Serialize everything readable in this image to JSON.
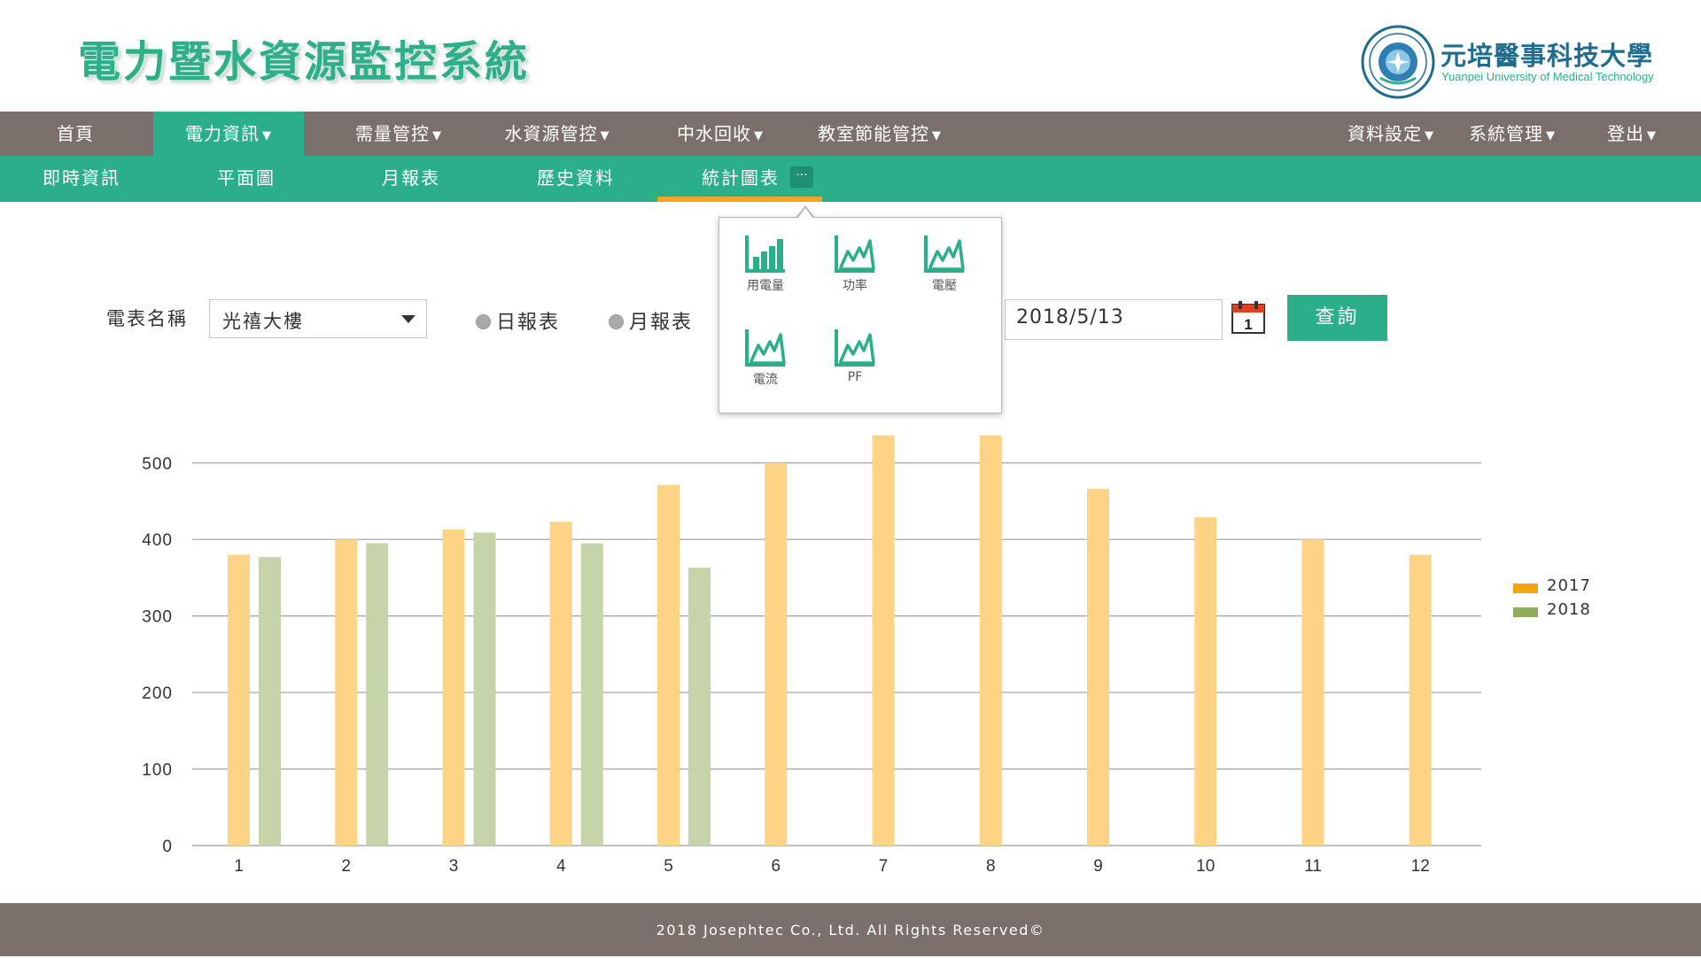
{
  "header": {
    "app_title": "電力暨水資源監控系統",
    "university_name": "元培醫事科技大學",
    "university_en": "Yuanpei University of Medical Technology"
  },
  "nav_main": {
    "items": [
      {
        "label": "首頁"
      },
      {
        "label": "電力資訊",
        "caret": "▼",
        "active": true
      },
      {
        "label": "需量管控",
        "caret": "▼"
      },
      {
        "label": "水資源管控",
        "caret": "▼"
      },
      {
        "label": "中水回收",
        "caret": "▼"
      },
      {
        "label": "教室節能管控",
        "caret": "▼"
      }
    ],
    "right_items": [
      {
        "label": "資料設定",
        "caret": "▼"
      },
      {
        "label": "系統管理",
        "caret": "▼"
      },
      {
        "label": "登出",
        "caret": "▼"
      }
    ]
  },
  "nav_sub": {
    "items": [
      {
        "label": "即時資訊"
      },
      {
        "label": "平面圖"
      },
      {
        "label": "月報表"
      },
      {
        "label": "歷史資料"
      },
      {
        "label": "統計圖表",
        "active": true
      }
    ],
    "more": "···"
  },
  "popup": {
    "items": [
      {
        "label": "用電量",
        "icon": "bar-chart-icon"
      },
      {
        "label": "功率",
        "icon": "line-chart-icon"
      },
      {
        "label": "電壓",
        "icon": "line-chart-icon"
      },
      {
        "label": "電流",
        "icon": "line-chart-icon"
      },
      {
        "label": "PF",
        "icon": "line-chart-icon"
      }
    ]
  },
  "form": {
    "meter_label": "電表名稱",
    "meter_value": "光禧大樓",
    "radio_daily": "日報表",
    "radio_monthly": "月報表",
    "date_value": "2018/5/13",
    "calendar_day": "1",
    "query_label": "查詢"
  },
  "colors": {
    "accent": "#2bae8a",
    "nav_bg": "#7a6f6b",
    "highlight": "#f2a324",
    "series_2017": "#fdd385",
    "series_2018": "#c5d4a9",
    "legend_2017": "#f4a40f",
    "legend_2018": "#8fad5a"
  },
  "chart_data": {
    "type": "bar",
    "categories": [
      "1",
      "2",
      "3",
      "4",
      "5",
      "6",
      "7",
      "8",
      "9",
      "10",
      "11",
      "12"
    ],
    "series": [
      {
        "name": "2017",
        "values": [
          380,
          400,
          413,
          423,
          471,
          500,
          536,
          536,
          466,
          429,
          400,
          380
        ]
      },
      {
        "name": "2018",
        "values": [
          377,
          395,
          409,
          395,
          363,
          null,
          null,
          null,
          null,
          null,
          null,
          null
        ]
      }
    ],
    "y_ticks": [
      0,
      100,
      200,
      300,
      400,
      500
    ],
    "ylim": [
      0,
      540
    ],
    "grid": true,
    "legend_position": "right"
  },
  "footer": {
    "text": "2018 Josephtec Co., Ltd. All Rights Reserved©"
  }
}
